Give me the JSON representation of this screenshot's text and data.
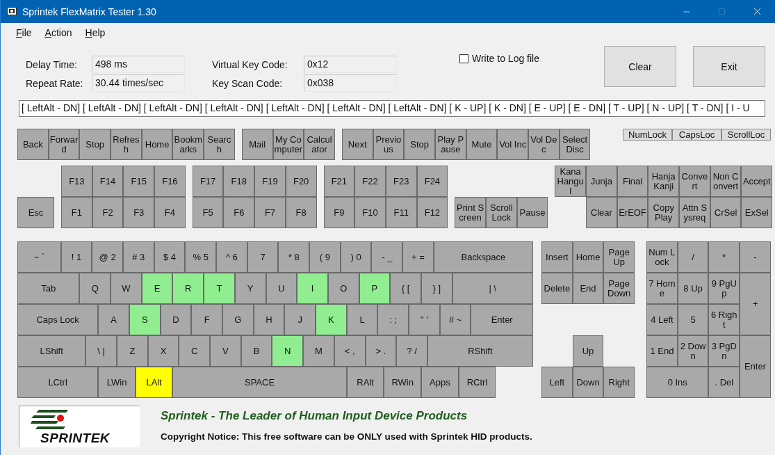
{
  "window": {
    "title": "Sprintek FlexMatrix Tester 1.30"
  },
  "menu": [
    "File",
    "Action",
    "Help"
  ],
  "fields": [
    {
      "label": "Delay Time:",
      "value": "498 ms"
    },
    {
      "label": "Repeat Rate:",
      "value": "30.44 times/sec"
    },
    {
      "label": "Virtual Key Code:",
      "value": "0x12"
    },
    {
      "label": "Key Scan Code:",
      "value": "0x038"
    }
  ],
  "log_to_file": {
    "label": "Write to Log file",
    "checked": false
  },
  "buttons": [
    "Clear",
    "Exit"
  ],
  "log": "[ LeftAlt - DN] [ LeftAlt - DN] [ LeftAlt - DN] [ LeftAlt - DN] [ LeftAlt - DN] [ LeftAlt - DN] [ LeftAlt - DN] [ K - UP] [ K - DN] [ E - UP] [ E - DN] [ T - UP] [ N - UP] [ T - DN] [ I - U",
  "media_keys": [
    [
      {
        "label": "Back",
        "pressed": false,
        "held": false
      },
      {
        "label": "Forward",
        "pressed": false,
        "held": false
      },
      {
        "label": "Stop",
        "pressed": false,
        "held": false
      },
      {
        "label": "Refresh",
        "pressed": false,
        "held": false
      },
      {
        "label": "Home",
        "pressed": false,
        "held": false
      },
      {
        "label": "Bookmarks",
        "pressed": false,
        "held": false
      },
      {
        "label": "Search",
        "pressed": false,
        "held": false
      }
    ],
    [
      {
        "label": "Mail",
        "pressed": false,
        "held": false
      },
      {
        "label": "My Computer",
        "pressed": false,
        "held": false
      },
      {
        "label": "Calculator",
        "pressed": false,
        "held": false
      }
    ],
    [
      {
        "label": "Next",
        "pressed": false,
        "held": false
      },
      {
        "label": "Previous",
        "pressed": false,
        "held": false
      },
      {
        "label": "Stop",
        "pressed": false,
        "held": false
      },
      {
        "label": "Play Pause",
        "pressed": false,
        "held": false
      },
      {
        "label": "Mute",
        "pressed": false,
        "held": false
      },
      {
        "label": "Vol Inc",
        "pressed": false,
        "held": false
      },
      {
        "label": "Vol Dec",
        "pressed": false,
        "held": false
      },
      {
        "label": "Select Disc",
        "pressed": false,
        "held": false
      }
    ]
  ],
  "lock_indicators": [
    "NumLock",
    "CapsLoc",
    "ScrollLoc"
  ],
  "escape_key": {
    "label": "Esc",
    "pressed": false,
    "held": false
  },
  "function_keys": [
    {
      "upper": [
        {
          "label": "F13",
          "pressed": false,
          "held": false
        },
        {
          "label": "F14",
          "pressed": false,
          "held": false
        },
        {
          "label": "F15",
          "pressed": false,
          "held": false
        },
        {
          "label": "F16",
          "pressed": false,
          "held": false
        }
      ],
      "lower": [
        {
          "label": "F1",
          "pressed": false,
          "held": false
        },
        {
          "label": "F2",
          "pressed": false,
          "held": false
        },
        {
          "label": "F3",
          "pressed": false,
          "held": false
        },
        {
          "label": "F4",
          "pressed": false,
          "held": false
        }
      ]
    },
    {
      "upper": [
        {
          "label": "F17",
          "pressed": false,
          "held": false
        },
        {
          "label": "F18",
          "pressed": false,
          "held": false
        },
        {
          "label": "F19",
          "pressed": false,
          "held": false
        },
        {
          "label": "F20",
          "pressed": false,
          "held": false
        }
      ],
      "lower": [
        {
          "label": "F5",
          "pressed": false,
          "held": false
        },
        {
          "label": "F6",
          "pressed": false,
          "held": false
        },
        {
          "label": "F7",
          "pressed": false,
          "held": false
        },
        {
          "label": "F8",
          "pressed": false,
          "held": false
        }
      ]
    },
    {
      "upper": [
        {
          "label": "F21",
          "pressed": false,
          "held": false
        },
        {
          "label": "F22",
          "pressed": false,
          "held": false
        },
        {
          "label": "F23",
          "pressed": false,
          "held": false
        },
        {
          "label": "F24",
          "pressed": false,
          "held": false
        }
      ],
      "lower": [
        {
          "label": "F9",
          "pressed": false,
          "held": false
        },
        {
          "label": "F10",
          "pressed": false,
          "held": false
        },
        {
          "label": "F11",
          "pressed": false,
          "held": false
        },
        {
          "label": "F12",
          "pressed": false,
          "held": false
        }
      ]
    }
  ],
  "system_keys": [
    {
      "label": "Print Screen",
      "pressed": false,
      "held": false
    },
    {
      "label": "Scroll Lock",
      "pressed": false,
      "held": false
    },
    {
      "label": "Pause",
      "pressed": false,
      "held": false
    }
  ],
  "extra_keys": {
    "upper": [
      {
        "label": "Kana Hangul",
        "pressed": false,
        "held": false
      },
      {
        "label": "Junja",
        "pressed": false,
        "held": false
      },
      {
        "label": "Final",
        "pressed": false,
        "held": false
      },
      {
        "label": "Hanja Kanji",
        "pressed": false,
        "held": false
      },
      {
        "label": "Convert",
        "pressed": false,
        "held": false
      },
      {
        "label": "Non Convert",
        "pressed": false,
        "held": false
      },
      {
        "label": "Accept",
        "pressed": false,
        "held": false
      }
    ],
    "lower": [
      {
        "label": "Clear",
        "pressed": false,
        "held": false
      },
      {
        "label": "ErEOF",
        "pressed": false,
        "held": false
      },
      {
        "label": "Copy Play",
        "pressed": false,
        "held": false
      },
      {
        "label": "Attn Sysreq",
        "pressed": false,
        "held": false
      },
      {
        "label": "CrSel",
        "pressed": false,
        "held": false
      },
      {
        "label": "ExSel",
        "pressed": false,
        "held": false
      }
    ]
  },
  "main_keys": [
    [
      {
        "label": "~ `",
        "pressed": false,
        "held": false
      },
      {
        "label": "! 1",
        "pressed": false,
        "held": false
      },
      {
        "label": "@ 2",
        "pressed": false,
        "held": false
      },
      {
        "label": "# 3",
        "pressed": false,
        "held": false
      },
      {
        "label": "$ 4",
        "pressed": false,
        "held": false
      },
      {
        "label": "% 5",
        "pressed": false,
        "held": false
      },
      {
        "label": "^ 6",
        "pressed": false,
        "held": false
      },
      {
        "label": "7",
        "pressed": false,
        "held": false
      },
      {
        "label": "* 8",
        "pressed": false,
        "held": false
      },
      {
        "label": "( 9",
        "pressed": false,
        "held": false
      },
      {
        "label": ") 0",
        "pressed": false,
        "held": false
      },
      {
        "label": "- _",
        "pressed": false,
        "held": false
      },
      {
        "label": "+ =",
        "pressed": false,
        "held": false
      },
      {
        "label": "Backspace",
        "pressed": false,
        "held": false
      }
    ],
    [
      {
        "label": "Tab",
        "pressed": false,
        "held": false
      },
      {
        "label": "Q",
        "pressed": false,
        "held": false
      },
      {
        "label": "W",
        "pressed": false,
        "held": false
      },
      {
        "label": "E",
        "pressed": true,
        "held": false
      },
      {
        "label": "R",
        "pressed": true,
        "held": false
      },
      {
        "label": "T",
        "pressed": true,
        "held": false
      },
      {
        "label": "Y",
        "pressed": false,
        "held": false
      },
      {
        "label": "U",
        "pressed": false,
        "held": false
      },
      {
        "label": "I",
        "pressed": true,
        "held": false
      },
      {
        "label": "O",
        "pressed": false,
        "held": false
      },
      {
        "label": "P",
        "pressed": true,
        "held": false
      },
      {
        "label": "{ [",
        "pressed": false,
        "held": false
      },
      {
        "label": "} ]",
        "pressed": false,
        "held": false
      },
      {
        "label": "| \\",
        "pressed": false,
        "held": false
      }
    ],
    [
      {
        "label": "Caps Lock",
        "pressed": false,
        "held": false
      },
      {
        "label": "A",
        "pressed": false,
        "held": false
      },
      {
        "label": "S",
        "pressed": true,
        "held": false
      },
      {
        "label": "D",
        "pressed": false,
        "held": false
      },
      {
        "label": "F",
        "pressed": false,
        "held": false
      },
      {
        "label": "G",
        "pressed": false,
        "held": false
      },
      {
        "label": "H",
        "pressed": false,
        "held": false
      },
      {
        "label": "J",
        "pressed": false,
        "held": false
      },
      {
        "label": "K",
        "pressed": true,
        "held": false
      },
      {
        "label": "L",
        "pressed": false,
        "held": false
      },
      {
        "label": ": ;",
        "pressed": false,
        "held": false
      },
      {
        "label": "\" '",
        "pressed": false,
        "held": false
      },
      {
        "label": "# ~",
        "pressed": false,
        "held": false
      },
      {
        "label": "Enter",
        "pressed": false,
        "held": false
      }
    ],
    [
      {
        "label": "LShift",
        "pressed": false,
        "held": false
      },
      {
        "label": "\\ |",
        "pressed": false,
        "held": false
      },
      {
        "label": "Z",
        "pressed": false,
        "held": false
      },
      {
        "label": "X",
        "pressed": false,
        "held": false
      },
      {
        "label": "C",
        "pressed": false,
        "held": false
      },
      {
        "label": "V",
        "pressed": false,
        "held": false
      },
      {
        "label": "B",
        "pressed": false,
        "held": false
      },
      {
        "label": "N",
        "pressed": true,
        "held": false
      },
      {
        "label": "M",
        "pressed": false,
        "held": false
      },
      {
        "label": "< ,",
        "pressed": false,
        "held": false
      },
      {
        "label": "> .",
        "pressed": false,
        "held": false
      },
      {
        "label": "? /",
        "pressed": false,
        "held": false
      },
      {
        "label": "RShift",
        "pressed": false,
        "held": false
      }
    ],
    [
      {
        "label": "LCtrl",
        "pressed": false,
        "held": false
      },
      {
        "label": "LWin",
        "pressed": false,
        "held": false
      },
      {
        "label": "LAlt",
        "pressed": false,
        "held": true
      },
      {
        "label": "SPACE",
        "pressed": false,
        "held": false
      },
      {
        "label": "RAlt",
        "pressed": false,
        "held": false
      },
      {
        "label": "RWin",
        "pressed": false,
        "held": false
      },
      {
        "label": "Apps",
        "pressed": false,
        "held": false
      },
      {
        "label": "RCtrl",
        "pressed": false,
        "held": false
      }
    ]
  ],
  "nav_keys": {
    "upper": [
      {
        "label": "Insert",
        "pressed": false,
        "held": false
      },
      {
        "label": "Home",
        "pressed": false,
        "held": false
      },
      {
        "label": "Page Up",
        "pressed": false,
        "held": false
      }
    ],
    "lower": [
      {
        "label": "Delete",
        "pressed": false,
        "held": false
      },
      {
        "label": "End",
        "pressed": false,
        "held": false
      },
      {
        "label": "Page Down",
        "pressed": false,
        "held": false
      }
    ]
  },
  "arrow_keys": {
    "up": {
      "label": "Up",
      "pressed": false,
      "held": false
    },
    "lower": [
      {
        "label": "Left",
        "pressed": false,
        "held": false
      },
      {
        "label": "Down",
        "pressed": false,
        "held": false
      },
      {
        "label": "Right",
        "pressed": false,
        "held": false
      }
    ]
  },
  "numpad": [
    {
      "label": "Num Lock",
      "pressed": false,
      "held": false
    },
    {
      "label": "/",
      "pressed": false,
      "held": false
    },
    {
      "label": "*",
      "pressed": false,
      "held": false
    },
    {
      "label": "-",
      "pressed": false,
      "held": false
    },
    {
      "label": "7 Home",
      "pressed": false,
      "held": false
    },
    {
      "label": "8 Up",
      "pressed": false,
      "held": false
    },
    {
      "label": "9 PgUp",
      "pressed": false,
      "held": false
    },
    {
      "label": "+",
      "pressed": false,
      "held": false
    },
    {
      "label": "4 Left",
      "pressed": false,
      "held": false
    },
    {
      "label": "5",
      "pressed": false,
      "held": false
    },
    {
      "label": "6 Right",
      "pressed": false,
      "held": false
    },
    {
      "label": "1 End",
      "pressed": false,
      "held": false
    },
    {
      "label": "2 Down",
      "pressed": false,
      "held": false
    },
    {
      "label": "3 PgDn",
      "pressed": false,
      "held": false
    },
    {
      "label": "Enter",
      "pressed": false,
      "held": false
    },
    {
      "label": "0 Ins",
      "pressed": false,
      "held": false
    },
    {
      "label": ". Del",
      "pressed": false,
      "held": false
    }
  ],
  "footer": {
    "logo": "SPRINTEK",
    "slogan": "Sprintek - The Leader of Human Input Device Products",
    "copyright": "Copyright Notice: This free software can be ONLY used with Sprintek HID products."
  }
}
